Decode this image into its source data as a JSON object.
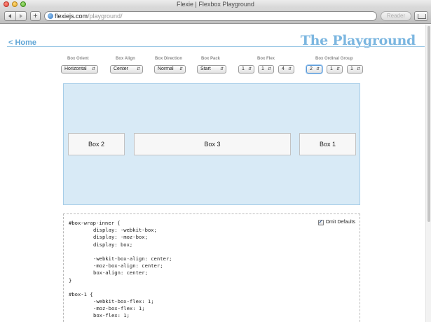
{
  "window": {
    "title": "Flexie | Flexbox Playground"
  },
  "toolbar": {
    "back_icon": "back-arrow-icon",
    "forward_icon": "forward-arrow-icon",
    "add_label": "+",
    "url_host": "flexiejs.com",
    "url_path": "/playground/",
    "reader_label": "Reader",
    "share_icon": "share-icon"
  },
  "page": {
    "home_link": "< Home",
    "title": "The Playground"
  },
  "controls": {
    "box_orient": {
      "label": "Box Orient",
      "value": "Horizontal"
    },
    "box_align": {
      "label": "Box Align",
      "value": "Center"
    },
    "box_direction": {
      "label": "Box Direction",
      "value": "Normal"
    },
    "box_pack": {
      "label": "Box Pack",
      "value": "Start"
    },
    "box_flex": {
      "label": "Box Flex",
      "values": [
        "1",
        "1",
        "4"
      ]
    },
    "box_ordinal_group": {
      "label": "Box Ordinal Group",
      "values": [
        "2",
        "1",
        "1"
      ]
    }
  },
  "stage": {
    "boxes": [
      "Box 2",
      "Box 3",
      "Box 1"
    ]
  },
  "code": {
    "omit_defaults_label": "Omit Defaults",
    "omit_defaults_checked": true,
    "lines": [
      {
        "text": "#box-wrap-inner {",
        "indent": false
      },
      {
        "text": "display: -webkit-box;",
        "indent": true
      },
      {
        "text": "display: -moz-box;",
        "indent": true
      },
      {
        "text": "display: box;",
        "indent": true
      },
      {
        "text": "",
        "indent": false
      },
      {
        "text": "-webkit-box-align: center;",
        "indent": true
      },
      {
        "text": "-moz-box-align: center;",
        "indent": true
      },
      {
        "text": "box-align: center;",
        "indent": true
      },
      {
        "text": "}",
        "indent": false
      },
      {
        "text": "",
        "indent": false
      },
      {
        "text": "#box-1 {",
        "indent": false
      },
      {
        "text": "-webkit-box-flex: 1;",
        "indent": true
      },
      {
        "text": "-moz-box-flex: 1;",
        "indent": true
      },
      {
        "text": "box-flex: 1;",
        "indent": true
      }
    ]
  }
}
